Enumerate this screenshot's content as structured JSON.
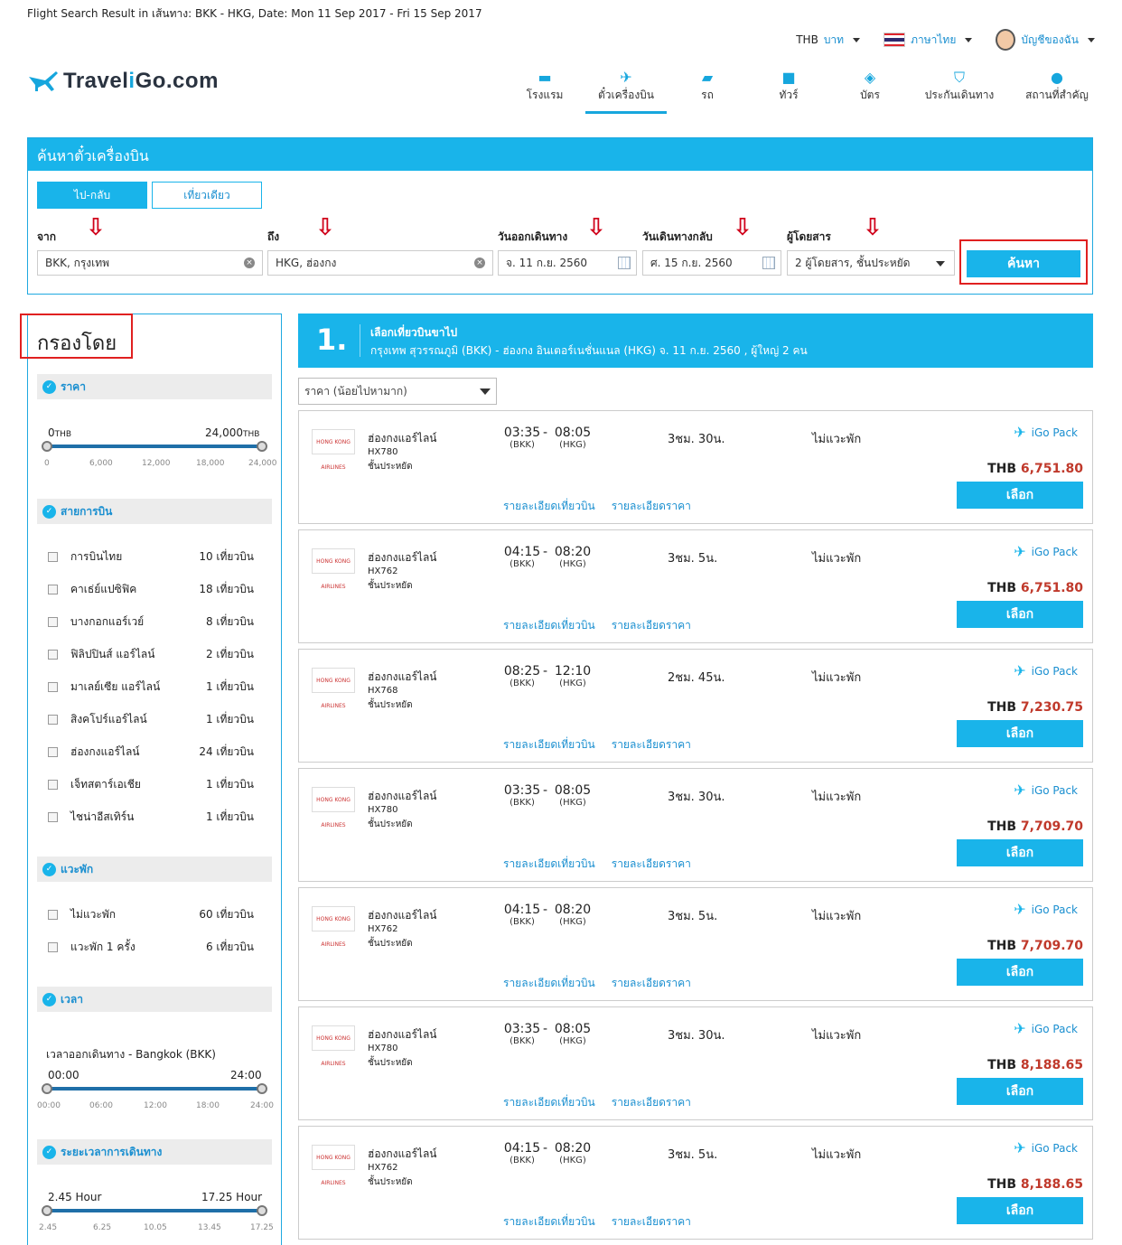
{
  "caption": "Flight Search Result in เส้นทาง: BKK - HKG, Date: Mon 11 Sep 2017 - Fri 15 Sep 2017",
  "topbar": {
    "currency": "THB",
    "currency_name": "บาท",
    "language": "ภาษาไทย",
    "account": "บัญชีของฉัน"
  },
  "logo": {
    "brand_a": "Travel",
    "brand_i": "i",
    "brand_b": "Go",
    "brand_c": ".com"
  },
  "nav": [
    {
      "label": "โรงแรม",
      "icon": "bed-icon"
    },
    {
      "label": "ตั๋วเครื่องบิน",
      "icon": "plane-icon"
    },
    {
      "label": "รถ",
      "icon": "car-icon"
    },
    {
      "label": "ทัวร์",
      "icon": "luggage-icon"
    },
    {
      "label": "บัตร",
      "icon": "ticket-icon"
    },
    {
      "label": "ประกันเดินทาง",
      "icon": "shield-icon"
    },
    {
      "label": "สถานที่สำคัญ",
      "icon": "pin-icon"
    }
  ],
  "search": {
    "title": "ค้นหาตั๋วเครื่องบิน",
    "round_trip": "ไป-กลับ",
    "one_way": "เที่ยวเดียว",
    "from_label": "จาก",
    "from_value": "BKK, กรุงเทพ",
    "to_label": "ถึง",
    "to_value": "HKG, ฮ่องกง",
    "depart_label": "วันออกเดินทาง",
    "depart_value": "จ. 11 ก.ย. 2560",
    "return_label": "วันเดินทางกลับ",
    "return_value": "ศ. 15 ก.ย. 2560",
    "pax_label": "ผู้โดยสาร",
    "pax_value": "2 ผู้โดยสาร, ชั้นประหยัด",
    "button": "ค้นหา"
  },
  "filter": {
    "title": "กรองโดย",
    "price": {
      "head": "ราคา",
      "min": "0",
      "max": "24,000",
      "unit": "THB",
      "ticks": [
        "0",
        "6,000",
        "12,000",
        "18,000",
        "24,000"
      ]
    },
    "airline": {
      "head": "สายการบิน",
      "items": [
        {
          "name": "การบินไทย",
          "count": "10 เที่ยวบิน"
        },
        {
          "name": "คาเธ่ย์แปซิฟิค",
          "count": "18 เที่ยวบิน"
        },
        {
          "name": "บางกอกแอร์เวย์",
          "count": "8 เที่ยวบิน"
        },
        {
          "name": "ฟิลิปปินส์ แอร์ไลน์",
          "count": "2 เที่ยวบิน"
        },
        {
          "name": "มาเลย์เซีย แอร์ไลน์",
          "count": "1 เที่ยวบิน"
        },
        {
          "name": "สิงคโปร์แอร์ไลน์",
          "count": "1 เที่ยวบิน"
        },
        {
          "name": "ฮ่องกงแอร์ไลน์",
          "count": "24 เที่ยวบิน"
        },
        {
          "name": "เจ็ทสตาร์เอเชีย",
          "count": "1 เที่ยวบิน"
        },
        {
          "name": "ไชน่าอีสเทิร์น",
          "count": "1 เที่ยวบิน"
        }
      ]
    },
    "stops": {
      "head": "แวะพัก",
      "items": [
        {
          "name": "ไม่แวะพัก",
          "count": "60 เที่ยวบิน"
        },
        {
          "name": "แวะพัก 1 ครั้ง",
          "count": "6 เที่ยวบิน"
        }
      ]
    },
    "time": {
      "head": "เวลา",
      "sub": "เวลาออกเดินทาง - Bangkok (BKK)",
      "min": "00:00",
      "max": "24:00",
      "ticks": [
        "00:00",
        "06:00",
        "12:00",
        "18:00",
        "24:00"
      ]
    },
    "duration": {
      "head": "ระยะเวลาการเดินทาง",
      "min": "2.45 Hour",
      "max": "17.25 Hour",
      "ticks": [
        "2.45",
        "6.25",
        "10.05",
        "13.45",
        "17.25"
      ]
    }
  },
  "results_head": {
    "num": "1.",
    "line1": "เลือกเที่ยวบินขาไป",
    "line2": "กรุงเทพ สุวรรณภูมิ (BKK) - ฮ่องกง อินเตอร์เนชั่นแนล (HKG)    จ. 11 ก.ย. 2560 , ผู้ใหญ่ 2 คน"
  },
  "sort": "ราคา (น้อยไปหามาก)",
  "common": {
    "detail_flight": "รายละเอียดเที่ยวบิน",
    "detail_price": "รายละเอียดราคา",
    "select": "เลือก",
    "pack": "iGo Pack",
    "currency": "THB",
    "dash": "-",
    "dep_code": "(BKK)",
    "arr_code": "(HKG)",
    "logo_text": "HONG KONG AIRLINES"
  },
  "flights": [
    {
      "airline": "ฮ่องกงแอร์ไลน์",
      "flight": "HX780",
      "cls": "ชั้นประหยัด",
      "dep": "03:35",
      "arr": "08:05",
      "dur": "3ชม. 30น.",
      "stop": "ไม่แวะพัก",
      "price": "6,751.80"
    },
    {
      "airline": "ฮ่องกงแอร์ไลน์",
      "flight": "HX762",
      "cls": "ชั้นประหยัด",
      "dep": "04:15",
      "arr": "08:20",
      "dur": "3ชม. 5น.",
      "stop": "ไม่แวะพัก",
      "price": "6,751.80"
    },
    {
      "airline": "ฮ่องกงแอร์ไลน์",
      "flight": "HX768",
      "cls": "ชั้นประหยัด",
      "dep": "08:25",
      "arr": "12:10",
      "dur": "2ชม. 45น.",
      "stop": "ไม่แวะพัก",
      "price": "7,230.75"
    },
    {
      "airline": "ฮ่องกงแอร์ไลน์",
      "flight": "HX780",
      "cls": "ชั้นประหยัด",
      "dep": "03:35",
      "arr": "08:05",
      "dur": "3ชม. 30น.",
      "stop": "ไม่แวะพัก",
      "price": "7,709.70"
    },
    {
      "airline": "ฮ่องกงแอร์ไลน์",
      "flight": "HX762",
      "cls": "ชั้นประหยัด",
      "dep": "04:15",
      "arr": "08:20",
      "dur": "3ชม. 5น.",
      "stop": "ไม่แวะพัก",
      "price": "7,709.70"
    },
    {
      "airline": "ฮ่องกงแอร์ไลน์",
      "flight": "HX780",
      "cls": "ชั้นประหยัด",
      "dep": "03:35",
      "arr": "08:05",
      "dur": "3ชม. 30น.",
      "stop": "ไม่แวะพัก",
      "price": "8,188.65"
    },
    {
      "airline": "ฮ่องกงแอร์ไลน์",
      "flight": "HX762",
      "cls": "ชั้นประหยัด",
      "dep": "04:15",
      "arr": "08:20",
      "dur": "3ชม. 5น.",
      "stop": "ไม่แวะพัก",
      "price": "8,188.65"
    }
  ]
}
